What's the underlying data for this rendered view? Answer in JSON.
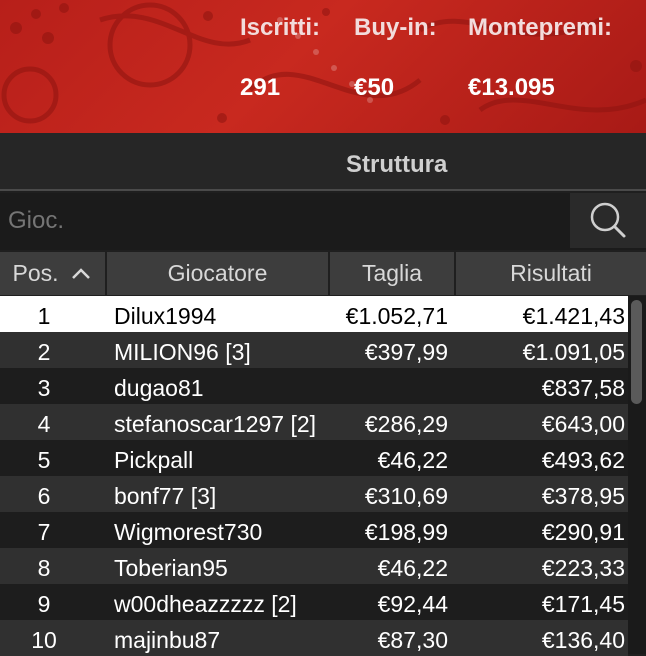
{
  "header": {
    "stats": [
      {
        "label": "Iscritti:",
        "value": "291"
      },
      {
        "label": "Buy-in:",
        "value": "€50"
      },
      {
        "label": "Montepremi:",
        "value": "€13.095"
      }
    ]
  },
  "structure": {
    "label": "Struttura"
  },
  "search": {
    "placeholder": "Gioc.",
    "icon": "search-icon"
  },
  "table": {
    "columns": [
      "Pos.",
      "Giocatore",
      "Taglia",
      "Risultati"
    ],
    "sort_icon": "chevron-up-icon",
    "rows": [
      {
        "pos": "1",
        "player": "Dilux1994",
        "size": "€1.052,71",
        "result": "€1.421,43"
      },
      {
        "pos": "2",
        "player": "MILION96 [3]",
        "size": "€397,99",
        "result": "€1.091,05"
      },
      {
        "pos": "3",
        "player": "dugao81",
        "size": "",
        "result": "€837,58"
      },
      {
        "pos": "4",
        "player": "stefanoscar1297 [2]",
        "size": "€286,29",
        "result": "€643,00"
      },
      {
        "pos": "5",
        "player": "Pickpall",
        "size": "€46,22",
        "result": "€493,62"
      },
      {
        "pos": "6",
        "player": "bonf77 [3]",
        "size": "€310,69",
        "result": "€378,95"
      },
      {
        "pos": "7",
        "player": "Wigmorest730",
        "size": "€198,99",
        "result": "€290,91"
      },
      {
        "pos": "8",
        "player": "Toberian95",
        "size": "€46,22",
        "result": "€223,33"
      },
      {
        "pos": "9",
        "player": "w00dheazzzzz [2]",
        "size": "€92,44",
        "result": "€171,45"
      },
      {
        "pos": "10",
        "player": "majinbu87",
        "size": "€87,30",
        "result": "€136,40"
      }
    ]
  },
  "colors": {
    "header_red": "#c8291f",
    "selected_row": "#ffffff",
    "dark_row": "#1d1d1d",
    "light_row": "#303030"
  }
}
